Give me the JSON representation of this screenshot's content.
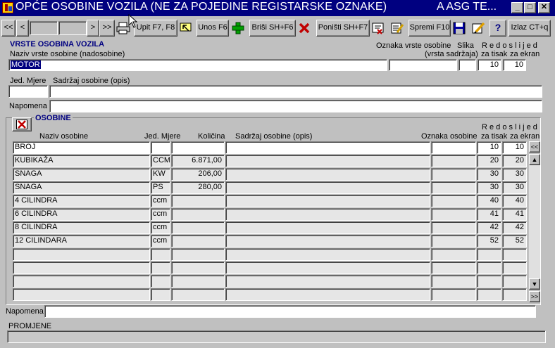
{
  "window": {
    "title": "OPĆE OSOBINE VOZILA (NE ZA POJEDINE REGISTARSKE OZNAKE)",
    "title_suffix": "A ASG TE...",
    "min": "_",
    "max": "□",
    "close": "✕"
  },
  "toolbar": {
    "first": "<<",
    "prev": "<",
    "next": ">",
    "last": ">>",
    "query": "Upit F7, F8",
    "insert": "Unos F6",
    "delete": "Briši SH+F6",
    "undo": "Poništi SH+F7",
    "save": "Spremi F10",
    "help": "?",
    "exit": "Izlaz CT+q"
  },
  "master": {
    "section_title": "VRSTE OSOBINA VOZILA",
    "name_label": "Naziv vrste osobine (nadosobine)",
    "name_value": "MOTOR",
    "code_label": "Oznaka vrste osobine",
    "code_label2": "(vrsta sadržaja)",
    "image_label": "Slika",
    "order_label": "R e d o s l i j e d",
    "print_label": "za tisak",
    "screen_label": "za ekran",
    "code_value": "",
    "image_value": "",
    "print_value": "10",
    "screen_value": "10",
    "unit_label": "Jed. Mjere",
    "content_label": "Sadržaj osobine (opis)",
    "unit_value": "",
    "content_value": "",
    "note_label": "Napomena",
    "note_value": ""
  },
  "detail": {
    "section_title": "OSOBINE",
    "columns": {
      "name": "Naziv osobine",
      "unit": "Jed. Mjere",
      "qty": "Količina",
      "content": "Sadržaj osobine (opis)",
      "code": "Oznaka osobine",
      "order": "R e d o s l i j e d",
      "print": "za tisak",
      "screen": "za ekran"
    },
    "rows": [
      {
        "name": "BROJ",
        "unit": "",
        "qty": "",
        "content": "",
        "code": "",
        "print": "10",
        "screen": "10"
      },
      {
        "name": "KUBIKAŽA",
        "unit": "CCM",
        "qty": "6.871,00",
        "content": "",
        "code": "",
        "print": "20",
        "screen": "20"
      },
      {
        "name": "SNAGA",
        "unit": "KW",
        "qty": "206,00",
        "content": "",
        "code": "",
        "print": "30",
        "screen": "30"
      },
      {
        "name": "SNAGA",
        "unit": "PS",
        "qty": "280,00",
        "content": "",
        "code": "",
        "print": "30",
        "screen": "30"
      },
      {
        "name": "4 CILINDRA",
        "unit": "ccm",
        "qty": "",
        "content": "",
        "code": "",
        "print": "40",
        "screen": "40"
      },
      {
        "name": "6 CILINDRA",
        "unit": "ccm",
        "qty": "",
        "content": "",
        "code": "",
        "print": "41",
        "screen": "41"
      },
      {
        "name": "8 CILINDRA",
        "unit": "ccm",
        "qty": "",
        "content": "",
        "code": "",
        "print": "42",
        "screen": "42"
      },
      {
        "name": "12 CILINDARA",
        "unit": "ccm",
        "qty": "",
        "content": "",
        "code": "",
        "print": "52",
        "screen": "52"
      },
      {
        "name": "",
        "unit": "",
        "qty": "",
        "content": "",
        "code": "",
        "print": "",
        "screen": ""
      },
      {
        "name": "",
        "unit": "",
        "qty": "",
        "content": "",
        "code": "",
        "print": "",
        "screen": ""
      },
      {
        "name": "",
        "unit": "",
        "qty": "",
        "content": "",
        "code": "",
        "print": "",
        "screen": ""
      },
      {
        "name": "",
        "unit": "",
        "qty": "",
        "content": "",
        "code": "",
        "print": "",
        "screen": ""
      }
    ],
    "scroll_top": "<<",
    "scroll_up": "▲",
    "scroll_down": "▼",
    "scroll_bottom": ">>",
    "note_label": "Napomena",
    "note_value": ""
  },
  "footer": {
    "changes_label": "PROMJENE",
    "changes_value": ""
  },
  "colors": {
    "titlebar": "#000080",
    "face": "#c0c0c0",
    "header_text": "#000080",
    "selected": "#000080"
  }
}
